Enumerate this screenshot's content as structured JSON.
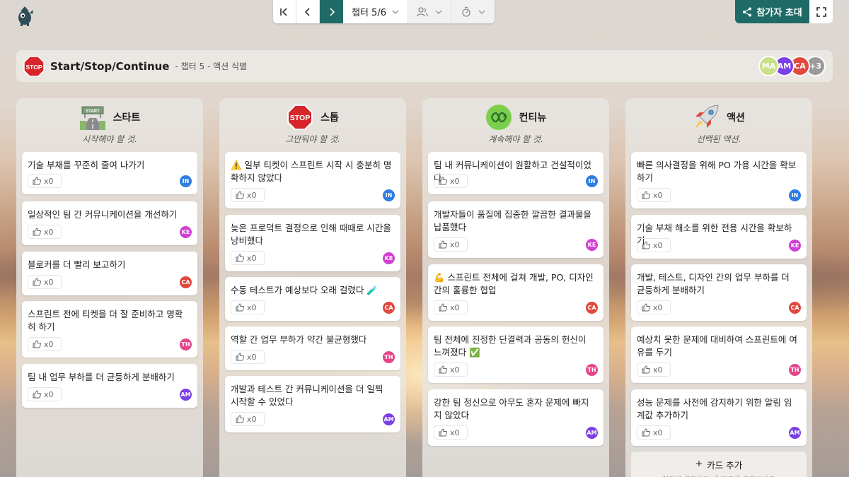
{
  "nav": {
    "chapter": "챕터 5/6"
  },
  "invite": {
    "label": "참가자 초대"
  },
  "header": {
    "title": "Start/Stop/Continue",
    "subtitle": "- 챕터 5 - 액션 식별",
    "avatars": [
      {
        "initials": "MA",
        "color": "#c9df8a"
      },
      {
        "initials": "AM",
        "color": "#7b3fe4"
      },
      {
        "initials": "CA",
        "color": "#e2483d"
      },
      {
        "initials": "+3",
        "color": "#9a9a9a"
      }
    ]
  },
  "users": {
    "IN": "#2f7de1",
    "KE": "#d13fd3",
    "CA": "#e2483d",
    "TH": "#e5458a",
    "AM": "#7b3fe4"
  },
  "columns": [
    {
      "title": "스타트",
      "desc": "시작해야 할 것.",
      "icon": "start-sign-icon",
      "cards": [
        {
          "text": "기술 부채를 꾸준히 줄여 나가기",
          "likes": "x0",
          "user": "IN"
        },
        {
          "text": "일상적인 팀 간 커뮤니케이션을 개선하기",
          "likes": "x0",
          "user": "KE"
        },
        {
          "text": "블로커를 더 빨리 보고하기",
          "likes": "x0",
          "user": "CA"
        },
        {
          "text": "스프린트 전에 티켓을 더 잘 준비하고 명확히 하기",
          "likes": "x0",
          "user": "TH"
        },
        {
          "text": "팀 내 업무 부하를 더 균등하게 분배하기",
          "likes": "x0",
          "user": "AM"
        }
      ]
    },
    {
      "title": "스톱",
      "desc": "그만둬야 할 것.",
      "icon": "stop-sign-icon",
      "cards": [
        {
          "text": "⚠️ 일부 티켓이 스프린트 시작 시 충분히 명확하지 않았다",
          "likes": "x0",
          "user": "IN"
        },
        {
          "text": "늦은 프로덕트 결정으로 인해 때때로 시간을 낭비했다",
          "likes": "x0",
          "user": "KE"
        },
        {
          "text": "수동 테스트가 예상보다 오래 걸렸다 🧪",
          "likes": "x0",
          "user": "CA"
        },
        {
          "text": "역할 간 업무 부하가 약간 불균형했다",
          "likes": "x0",
          "user": "TH"
        },
        {
          "text": "개발과 테스트 간 커뮤니케이션을 더 일찍 시작할 수 있었다",
          "likes": "x0",
          "user": "AM"
        }
      ]
    },
    {
      "title": "컨티뉴",
      "desc": "계속해야 할 것.",
      "icon": "continue-loop-icon",
      "cards": [
        {
          "text": "팀 내 커뮤니케이션이 원활하고 건설적이었다",
          "likes": "x0",
          "user": "IN"
        },
        {
          "text": "개발자들이 품질에 집중한 깔끔한 결과물을 납품했다",
          "likes": "x0",
          "user": "KE"
        },
        {
          "text": "💪 스프린트 전체에 걸쳐 개발, PO, 디자인 간의 훌륭한 협업",
          "likes": "x0",
          "user": "CA"
        },
        {
          "text": "팀 전체에 진정한 단결력과 공동의 헌신이 느껴졌다 ✅",
          "likes": "x0",
          "user": "TH"
        },
        {
          "text": "강한 팀 정신으로 아무도 혼자 문제에 빠지지 않았다",
          "likes": "x0",
          "user": "AM"
        }
      ]
    },
    {
      "title": "액션",
      "desc": "선택된 액션.",
      "icon": "rocket-icon",
      "cards": [
        {
          "text": "빠른 의사결정을 위해 PO 가용 시간을 확보하기",
          "likes": "x0",
          "user": "IN"
        },
        {
          "text": "기술 부채 해소를 위한 전용 시간을 확보하기",
          "likes": "x0",
          "user": "KE"
        },
        {
          "text": "개발, 테스트, 디자인 간의 업무 부하를 더 균등하게 분배하기",
          "likes": "x0",
          "user": "CA"
        },
        {
          "text": "예상치 못한 문제에 대비하여 스프린트에 여유를 두기",
          "likes": "x0",
          "user": "TH"
        },
        {
          "text": "성능 문제를 사전에 감지하기 위한 알림 임계값 추가하기",
          "likes": "x0",
          "user": "AM"
        }
      ],
      "add_card": {
        "label": "카드 추가",
        "hint": "여기를 클릭하여 새 카드를 추가하세요"
      }
    }
  ]
}
